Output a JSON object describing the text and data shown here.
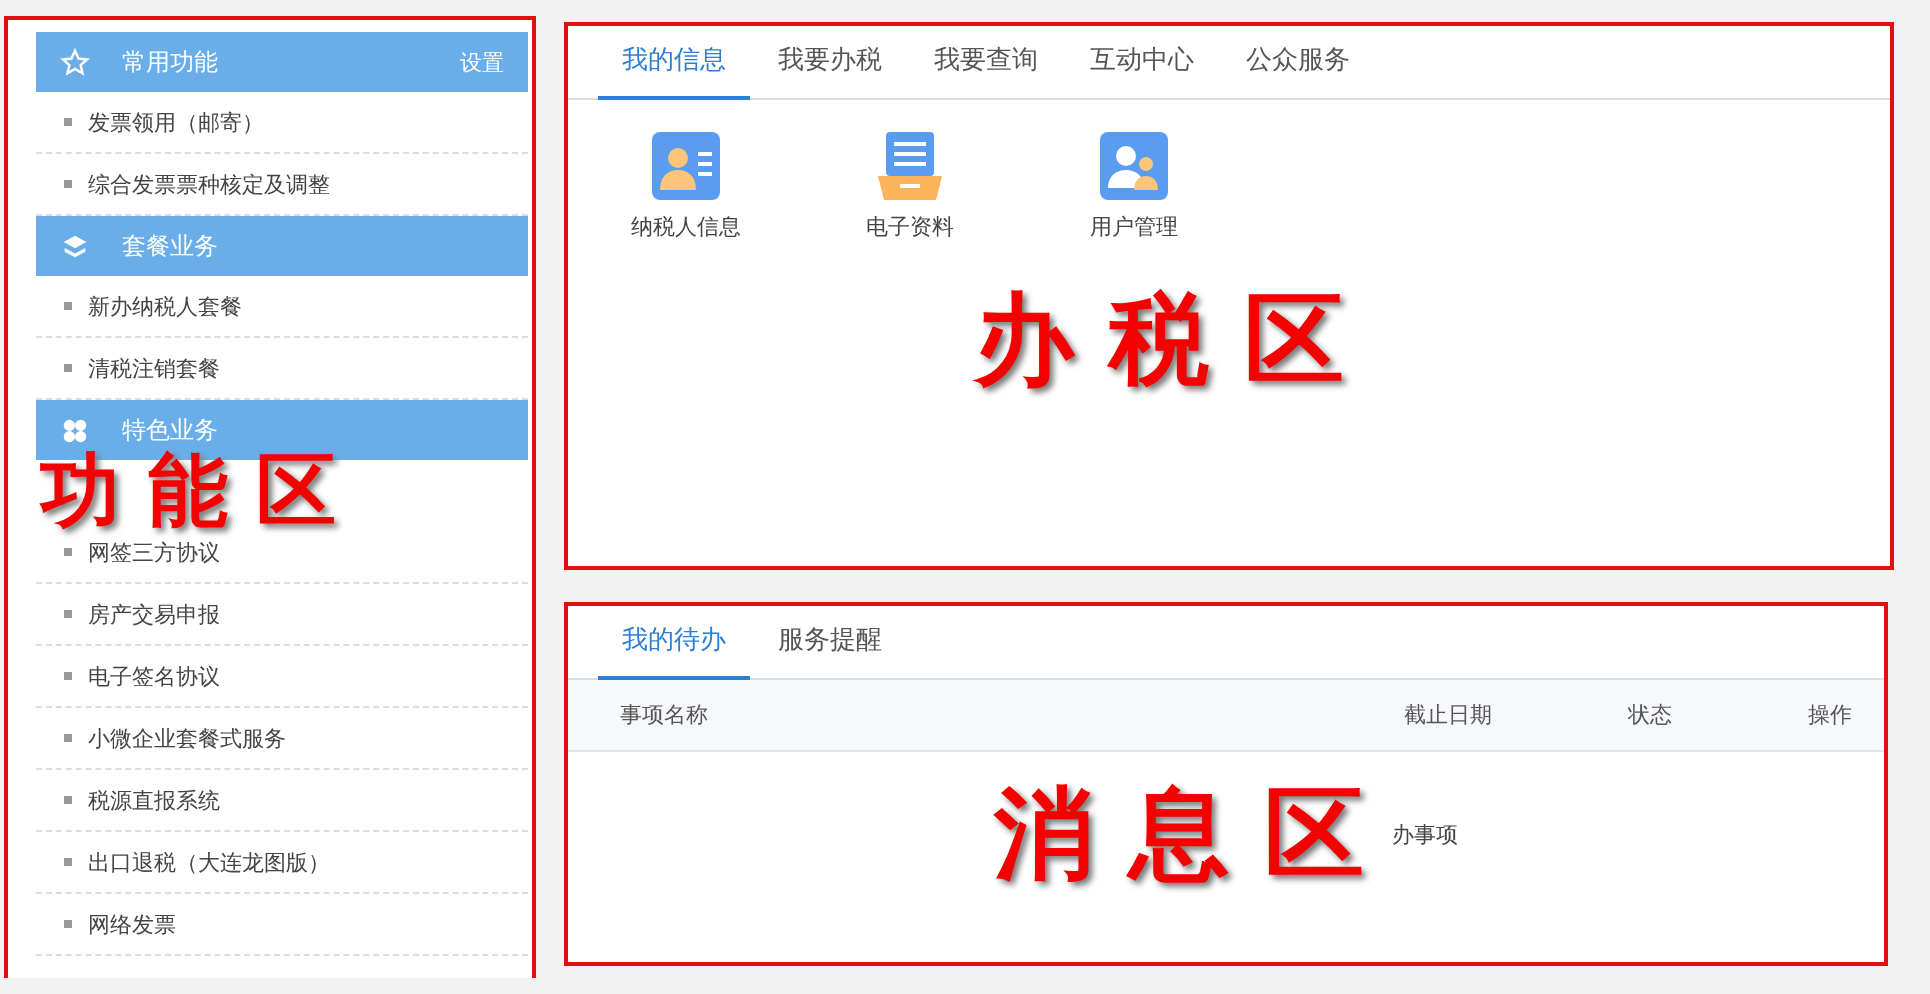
{
  "sidebar": {
    "sections": [
      {
        "kind": "favorites",
        "title": "常用功能",
        "action": "设置",
        "items": [
          "发票领用（邮寄）",
          "综合发票票种核定及调整"
        ]
      },
      {
        "kind": "packages",
        "title": "套餐业务",
        "items": [
          "新办纳税人套餐",
          "清税注销套餐"
        ]
      },
      {
        "kind": "featured",
        "title": "特色业务",
        "annotation": "功 能 区",
        "items": [
          "网签三方协议",
          "房产交易申报",
          "电子签名协议",
          "小微企业套餐式服务",
          "税源直报系统",
          "出口退税（大连龙图版）",
          "网络发票"
        ]
      }
    ]
  },
  "tax_panel": {
    "annotation": "办 税 区",
    "tabs": [
      {
        "label": "我的信息",
        "selected": true
      },
      {
        "label": "我要办税",
        "selected": false
      },
      {
        "label": "我要查询",
        "selected": false
      },
      {
        "label": "互动中心",
        "selected": false
      },
      {
        "label": "公众服务",
        "selected": false
      }
    ],
    "shortcuts": [
      {
        "kind": "person-card",
        "label": "纳税人信息"
      },
      {
        "kind": "document-tray",
        "label": "电子资料"
      },
      {
        "kind": "users",
        "label": "用户管理"
      }
    ]
  },
  "message_panel": {
    "annotation": "消 息 区",
    "tabs": [
      {
        "label": "我的待办",
        "selected": true
      },
      {
        "label": "服务提醒",
        "selected": false
      }
    ],
    "columns": [
      "事项名称",
      "截止日期",
      "状态",
      "操作"
    ],
    "empty_text": "办事项"
  }
}
